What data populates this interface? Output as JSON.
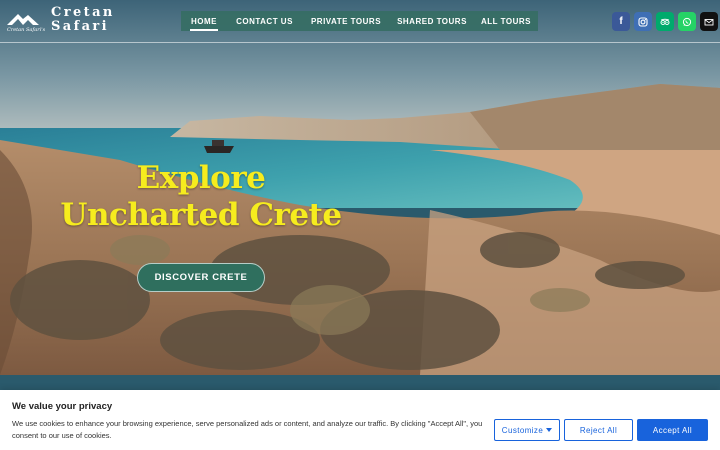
{
  "header": {
    "logo": {
      "text": "Cretan Safari",
      "tagline": "Cretan Safari's"
    },
    "nav": [
      {
        "label": "HOME",
        "active": true
      },
      {
        "label": "CONTACT US",
        "active": false
      },
      {
        "label": "PRIVATE TOURS",
        "active": false
      },
      {
        "label": "SHARED TOURS",
        "active": false
      },
      {
        "label": "ALL TOURS",
        "active": false
      }
    ],
    "socials": [
      {
        "icon": "facebook-icon",
        "glyph": "f",
        "color": "#3b5998"
      },
      {
        "icon": "instagram-icon",
        "glyph": "",
        "color": "#3f6fb5"
      },
      {
        "icon": "tripadvisor-icon",
        "glyph": "",
        "color": "#00aa6c"
      },
      {
        "icon": "whatsapp-icon",
        "glyph": "",
        "color": "#25d366"
      },
      {
        "icon": "email-icon",
        "glyph": "",
        "color": "#111111"
      }
    ]
  },
  "hero": {
    "title": "Explore Uncharted Crete",
    "cta": "DISCOVER CRETE",
    "title_color": "#f6ec1e"
  },
  "cookie": {
    "title": "We value your privacy",
    "text": "We use cookies to enhance your browsing experience, serve personalized ads or content, and analyze our traffic. By clicking \"Accept All\", you consent to our use of cookies.",
    "customize": "Customize",
    "reject": "Reject All",
    "accept": "Accept All",
    "accent": "#1863dc"
  }
}
